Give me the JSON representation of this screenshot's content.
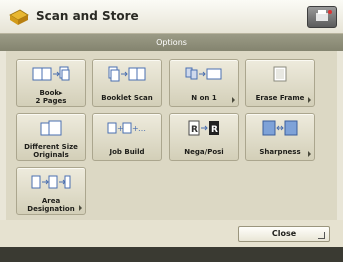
{
  "header": {
    "title": "Scan and Store"
  },
  "options": {
    "label": "Options"
  },
  "buttons": [
    {
      "id": "book-to-2-pages",
      "line1": "Book▸",
      "line2": "2 Pages"
    },
    {
      "id": "booklet-scan",
      "line1": "Booklet Scan"
    },
    {
      "id": "n-on-1",
      "line1": "N on 1"
    },
    {
      "id": "erase-frame",
      "line1": "Erase Frame"
    },
    {
      "id": "different-size-originals",
      "line1": "Different Size",
      "line2": "Originals"
    },
    {
      "id": "job-build",
      "line1": "Job Build"
    },
    {
      "id": "nega-posi",
      "line1": "Nega/Posi"
    },
    {
      "id": "sharpness",
      "line1": "Sharpness"
    },
    {
      "id": "area-designation",
      "line1": "Area",
      "line2": "Designation"
    }
  ],
  "footer": {
    "close_label": "Close"
  },
  "colors": {
    "accent": "#84846f",
    "panel": "#dcd8c4",
    "bottom_bar": "#3a3a32"
  }
}
